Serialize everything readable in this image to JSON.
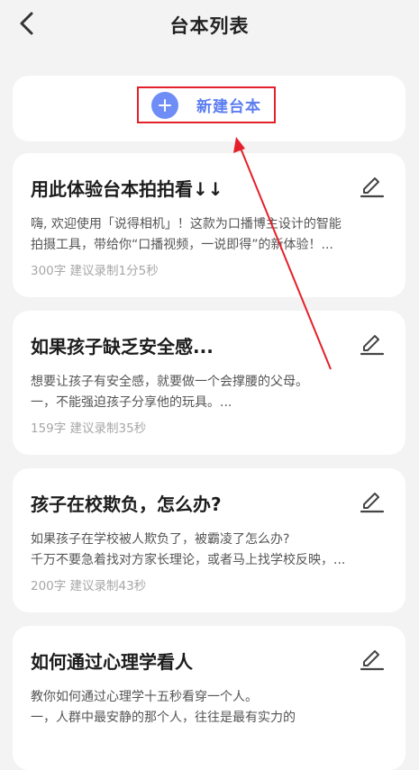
{
  "header": {
    "title": "台本列表",
    "back_icon": "chevron-left-icon"
  },
  "new_script": {
    "label": "新建台本",
    "icon": "plus-circle-icon",
    "accent": "#6e8df6",
    "highlight": "#e4202a"
  },
  "scripts": [
    {
      "title": "用此体验台本拍拍看↓↓",
      "desc": "嗨, 欢迎使用「说得相机」！这款为口播博主设计的智能\n拍摄工具，带给你“口播视频，一说即得”的新体验！...",
      "meta": "300字 建议录制1分5秒"
    },
    {
      "title": "如果孩子缺乏安全感...",
      "desc": "想要让孩子有安全感，就要做一个会撑腰的父母。\n一，不能强迫孩子分享他的玩具。...",
      "meta": "159字 建议录制35秒"
    },
    {
      "title": "孩子在校欺负，怎么办?",
      "desc": "如果孩子在学校被人欺负了，被霸凌了怎么办?\n千万不要急着找对方家长理论，或者马上找学校反映，...",
      "meta": "200字 建议录制43秒"
    },
    {
      "title": "如何通过心理学看人",
      "desc": "教你如何通过心理学十五秒看穿一个人。\n一，人群中最安静的那个人，往往是最有实力的",
      "meta": ""
    }
  ]
}
